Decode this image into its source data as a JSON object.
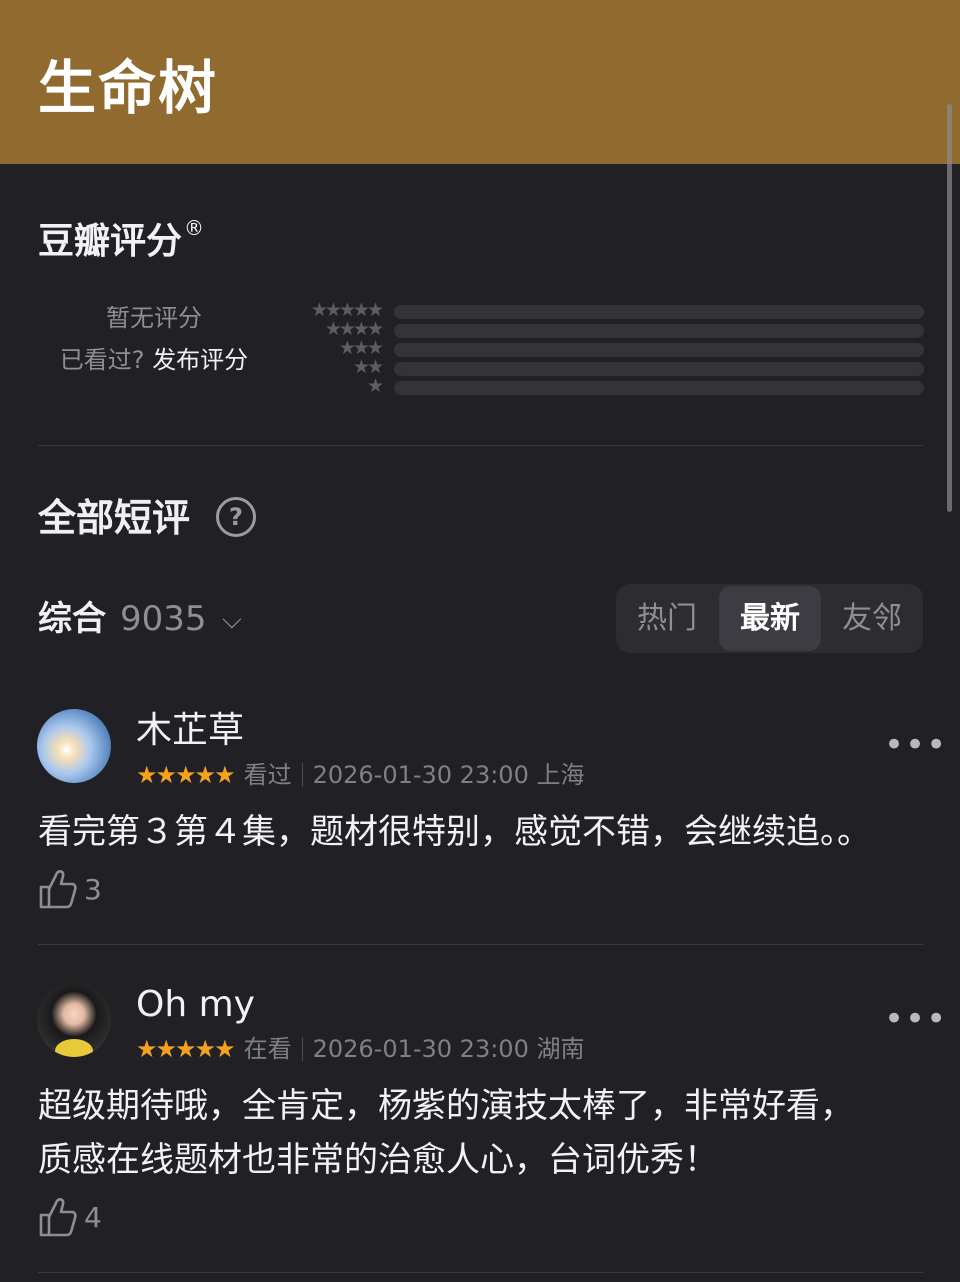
{
  "header": {
    "title": "生命树"
  },
  "rating": {
    "heading": "豆瓣评分",
    "registered_mark": "®",
    "no_rating": "暂无评分",
    "seen_prompt": "已看过?",
    "publish_label": "发布评分",
    "distribution": [
      {
        "stars": "★★★★★"
      },
      {
        "stars": "★★★★"
      },
      {
        "stars": "★★★"
      },
      {
        "stars": "★★"
      },
      {
        "stars": "★"
      }
    ]
  },
  "comments": {
    "heading": "全部短评",
    "help": "?",
    "sort_label": "综合",
    "count": "9035",
    "chevron": "⌵",
    "tabs": [
      {
        "label": "热门",
        "active": false
      },
      {
        "label": "最新",
        "active": true
      },
      {
        "label": "友邻",
        "active": false
      }
    ],
    "items": [
      {
        "user": "木芷草",
        "stars": "★★★★★",
        "status": "看过",
        "date": "2026-01-30 23:00",
        "location": "上海",
        "text": "看完第３第４集，题材很特别，感觉不错，会继续追。。",
        "likes": "3",
        "more": "•••"
      },
      {
        "user": "Oh my",
        "stars": "★★★★★",
        "status": "在看",
        "date": "2026-01-30 23:00",
        "location": "湖南",
        "text_line1": "超级期待哦，全肯定，杨紫的演技太棒了，非常好看，",
        "text_line2": "质感在线题材也非常的治愈人心，台词优秀！",
        "likes": "4",
        "more": "•••"
      }
    ]
  },
  "colors": {
    "header_bg": "#906a2f",
    "page_bg": "#212125",
    "star": "#f4a21c"
  }
}
